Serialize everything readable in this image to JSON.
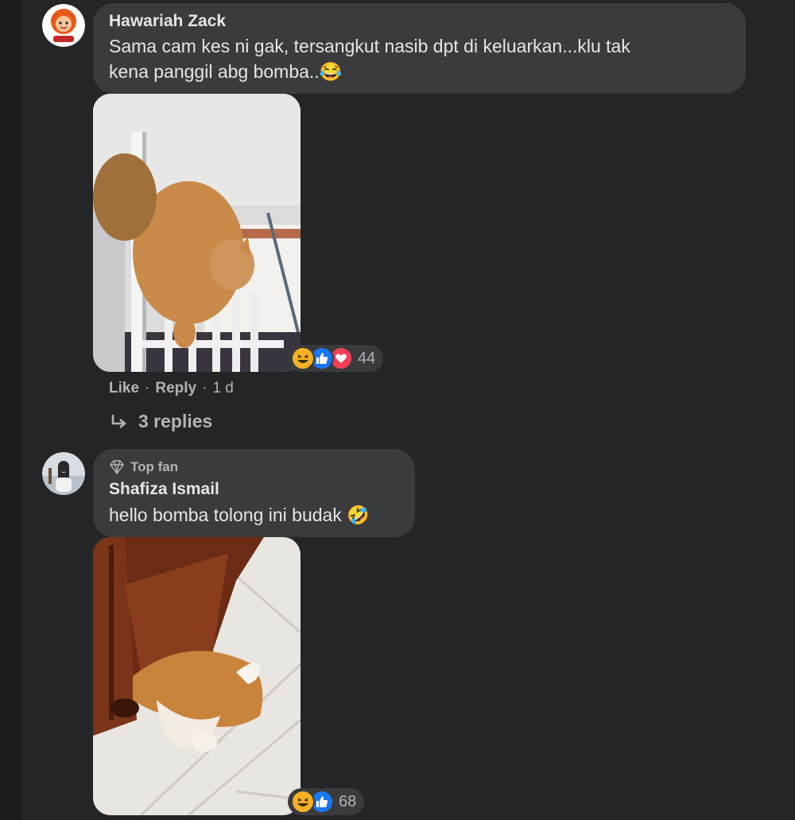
{
  "comments": [
    {
      "author": "Hawariah Zack",
      "text_line1": "Sama cam kes ni gak, tersangkut nasib dpt di keluarkan...klu tak",
      "text_line2": "kena panggil abg bomba..",
      "text_emoji": "😂",
      "reaction_icons": [
        "haha-icon",
        "like-icon",
        "love-icon"
      ],
      "reaction_count": "44",
      "actions": {
        "like": "Like",
        "reply": "Reply",
        "time": "1 d"
      },
      "replies_label": "3 replies"
    },
    {
      "badge": "Top fan",
      "author": "Shafiza Ismail",
      "text": "hello bomba tolong ini budak",
      "text_emoji": "🤣",
      "reaction_icons": [
        "haha-icon",
        "like-icon"
      ],
      "reaction_count": "68"
    }
  ],
  "colors": {
    "background": "#242526",
    "bubble": "#3a3b3c",
    "text_primary": "#e4e6eb",
    "text_secondary": "#b0b3b8",
    "like_blue": "#1877f2",
    "love_red": "#f33e58",
    "haha_yellow": "#f7b125"
  }
}
